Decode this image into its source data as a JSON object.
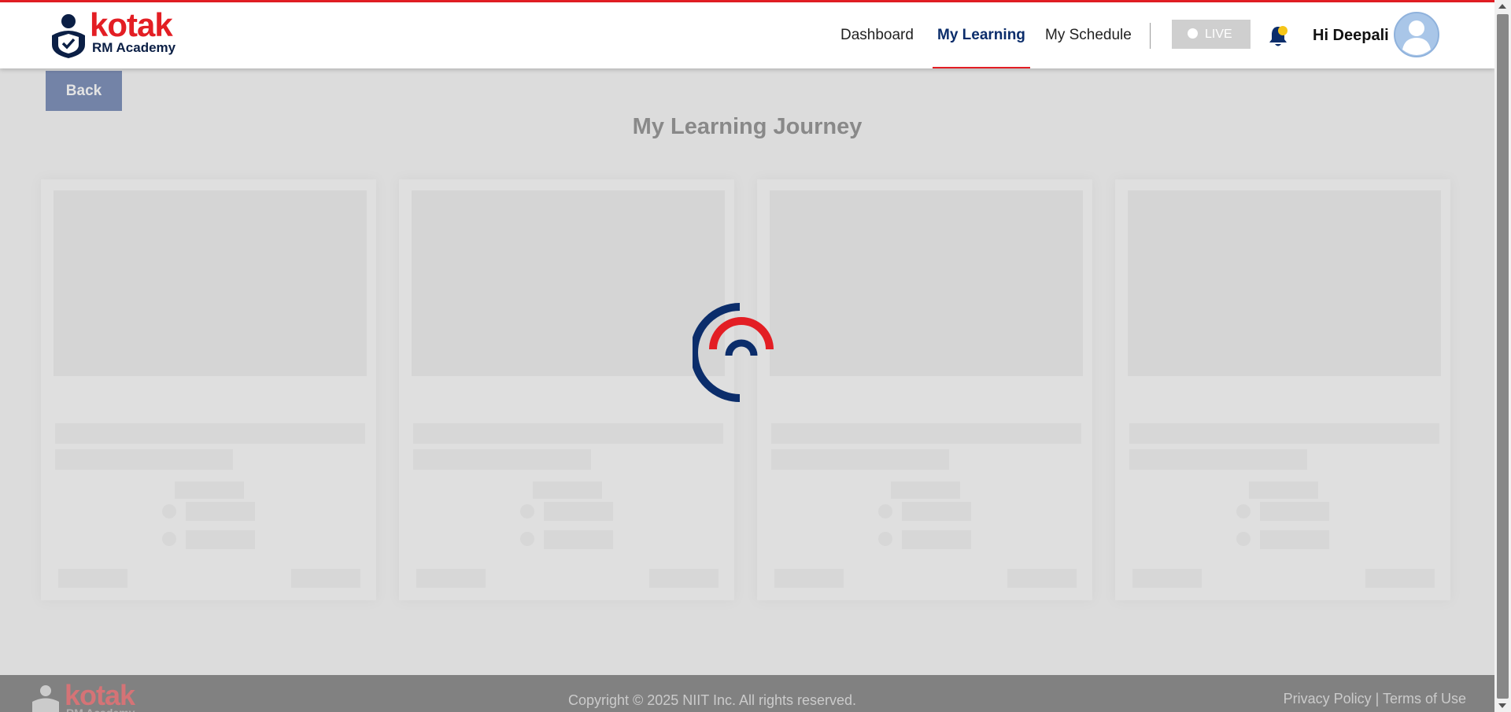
{
  "brand": {
    "name": "kotak",
    "subtitle": "RM Academy",
    "primary_color": "#e31e24",
    "navy_color": "#0b2d6b"
  },
  "nav": {
    "items": [
      {
        "label": "Dashboard",
        "active": false
      },
      {
        "label": "My Learning",
        "active": true
      },
      {
        "label": "My Schedule",
        "active": false
      }
    ],
    "live_label": "LIVE",
    "bell_icon": "bell-icon",
    "greeting": "Hi Deepali",
    "avatar_icon": "user-avatar-icon"
  },
  "page": {
    "back_label": "Back",
    "title": "My Learning Journey",
    "loading": true,
    "skeleton_card_count": 4
  },
  "footer": {
    "copyright": "Copyright © 2025 NIIT Inc. All rights reserved.",
    "privacy": "Privacy Policy",
    "separator": " | ",
    "terms": "Terms of Use"
  }
}
